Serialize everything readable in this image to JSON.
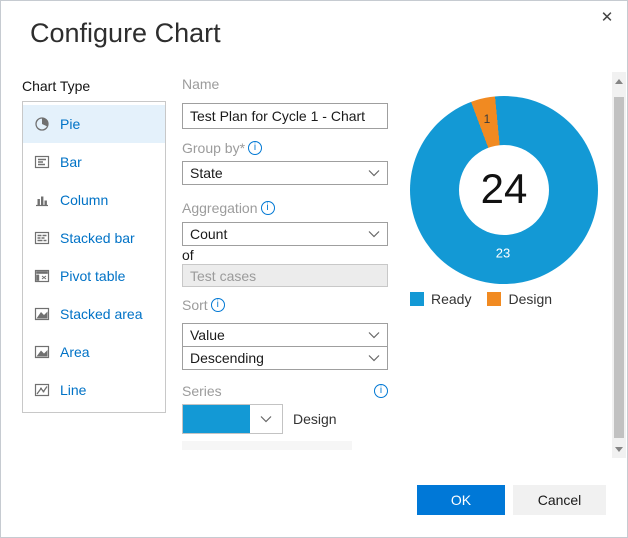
{
  "dialog": {
    "title": "Configure Chart"
  },
  "icons": {
    "close": "✕",
    "info_letter": "i"
  },
  "sidebar": {
    "heading": "Chart Type",
    "items": [
      {
        "label": "Pie",
        "selected": true
      },
      {
        "label": "Bar",
        "selected": false
      },
      {
        "label": "Column",
        "selected": false
      },
      {
        "label": "Stacked bar",
        "selected": false
      },
      {
        "label": "Pivot table",
        "selected": false
      },
      {
        "label": "Stacked area",
        "selected": false
      },
      {
        "label": "Area",
        "selected": false
      },
      {
        "label": "Line",
        "selected": false
      }
    ]
  },
  "form": {
    "name_label": "Name",
    "name_value": "Test Plan for Cycle 1 - Chart",
    "group_by_label": "Group by*",
    "group_by_value": "State",
    "aggregation_label": "Aggregation",
    "aggregation_value": "Count",
    "of_label": "of",
    "of_field_value": "Test cases",
    "sort_label": "Sort",
    "sort_by_value": "Value",
    "sort_order_value": "Descending",
    "series_label": "Series",
    "series_rows": [
      {
        "label": "Design",
        "swatch_color": "#1399d5"
      }
    ]
  },
  "chart_data": {
    "type": "pie",
    "subtype": "donut",
    "title": "",
    "categories": [
      "Ready",
      "Design"
    ],
    "values": [
      23,
      1
    ],
    "colors": [
      "#1399d5",
      "#f18a21"
    ],
    "total_label": "24",
    "legend_position": "bottom"
  },
  "footer": {
    "ok_label": "OK",
    "cancel_label": "Cancel"
  }
}
